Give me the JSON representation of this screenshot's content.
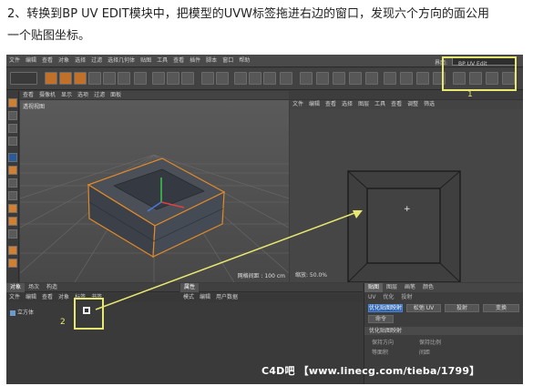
{
  "caption": {
    "line1": "2、转换到BP UV EDIT模块中，把模型的UVW标签拖进右边的窗口，发现六个方向的面公用",
    "line2": "一个贴图坐标。"
  },
  "app": {
    "menu": [
      "文件",
      "编辑",
      "查看",
      "对象",
      "选择",
      "过滤",
      "选择几何体",
      "贴图",
      "工具",
      "查看",
      "插件",
      "脚本",
      "窗口",
      "帮助"
    ],
    "layout_label": "界面:",
    "layout_value": "BP UV Edit",
    "callout_1": "1",
    "callout_2": "2"
  },
  "left_viewport": {
    "menu": [
      "查看",
      "摄像机",
      "显示",
      "选项",
      "过滤",
      "面板"
    ],
    "name": "透视视图",
    "status": "网格间距 : 100 cm"
  },
  "right_viewport": {
    "menu": [
      "文件",
      "编辑",
      "查看",
      "选择",
      "图层",
      "工具",
      "查看",
      "调整",
      "筛选"
    ],
    "zoom": "缩放: 50.0%"
  },
  "objects_panel": {
    "tabs": [
      "对象",
      "场次",
      "构造"
    ],
    "menu": [
      "文件",
      "编辑",
      "查看",
      "对象",
      "标签",
      "书签"
    ],
    "object_name": "立方体"
  },
  "attributes_panel": {
    "tabs": [
      "属性"
    ],
    "menu": [
      "模式",
      "编辑",
      "用户数据"
    ]
  },
  "uv_panel": {
    "tabs": [
      "贴图",
      "图层",
      "画笔",
      "颜色"
    ],
    "sub_tabs": [
      "UV",
      "优化",
      "投射"
    ],
    "buttons": [
      "优化贴图映射",
      "松弛 UV",
      "投射",
      "变换"
    ],
    "small_button": "命令",
    "section": "优化贴图映射",
    "options": [
      "保持方向",
      "保持比例",
      "等面积",
      "间距"
    ]
  },
  "watermark": "C4D吧 【www.linecg.com/tieba/1799】",
  "colors": {
    "highlight": "#e8e870",
    "model_edge": "#e08a2a",
    "ui_dark": "#3c3c3c",
    "active_blue": "#2b62b0"
  }
}
